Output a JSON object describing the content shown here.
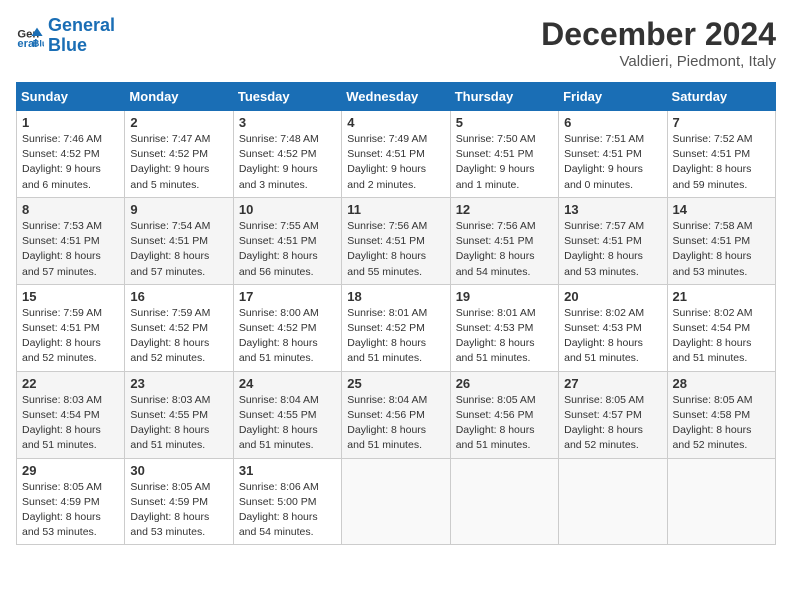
{
  "header": {
    "logo_line1": "General",
    "logo_line2": "Blue",
    "month": "December 2024",
    "location": "Valdieri, Piedmont, Italy"
  },
  "weekdays": [
    "Sunday",
    "Monday",
    "Tuesday",
    "Wednesday",
    "Thursday",
    "Friday",
    "Saturday"
  ],
  "weeks": [
    [
      {
        "day": "1",
        "info": "Sunrise: 7:46 AM\nSunset: 4:52 PM\nDaylight: 9 hours\nand 6 minutes."
      },
      {
        "day": "2",
        "info": "Sunrise: 7:47 AM\nSunset: 4:52 PM\nDaylight: 9 hours\nand 5 minutes."
      },
      {
        "day": "3",
        "info": "Sunrise: 7:48 AM\nSunset: 4:52 PM\nDaylight: 9 hours\nand 3 minutes."
      },
      {
        "day": "4",
        "info": "Sunrise: 7:49 AM\nSunset: 4:51 PM\nDaylight: 9 hours\nand 2 minutes."
      },
      {
        "day": "5",
        "info": "Sunrise: 7:50 AM\nSunset: 4:51 PM\nDaylight: 9 hours\nand 1 minute."
      },
      {
        "day": "6",
        "info": "Sunrise: 7:51 AM\nSunset: 4:51 PM\nDaylight: 9 hours\nand 0 minutes."
      },
      {
        "day": "7",
        "info": "Sunrise: 7:52 AM\nSunset: 4:51 PM\nDaylight: 8 hours\nand 59 minutes."
      }
    ],
    [
      {
        "day": "8",
        "info": "Sunrise: 7:53 AM\nSunset: 4:51 PM\nDaylight: 8 hours\nand 57 minutes."
      },
      {
        "day": "9",
        "info": "Sunrise: 7:54 AM\nSunset: 4:51 PM\nDaylight: 8 hours\nand 57 minutes."
      },
      {
        "day": "10",
        "info": "Sunrise: 7:55 AM\nSunset: 4:51 PM\nDaylight: 8 hours\nand 56 minutes."
      },
      {
        "day": "11",
        "info": "Sunrise: 7:56 AM\nSunset: 4:51 PM\nDaylight: 8 hours\nand 55 minutes."
      },
      {
        "day": "12",
        "info": "Sunrise: 7:56 AM\nSunset: 4:51 PM\nDaylight: 8 hours\nand 54 minutes."
      },
      {
        "day": "13",
        "info": "Sunrise: 7:57 AM\nSunset: 4:51 PM\nDaylight: 8 hours\nand 53 minutes."
      },
      {
        "day": "14",
        "info": "Sunrise: 7:58 AM\nSunset: 4:51 PM\nDaylight: 8 hours\nand 53 minutes."
      }
    ],
    [
      {
        "day": "15",
        "info": "Sunrise: 7:59 AM\nSunset: 4:51 PM\nDaylight: 8 hours\nand 52 minutes."
      },
      {
        "day": "16",
        "info": "Sunrise: 7:59 AM\nSunset: 4:52 PM\nDaylight: 8 hours\nand 52 minutes."
      },
      {
        "day": "17",
        "info": "Sunrise: 8:00 AM\nSunset: 4:52 PM\nDaylight: 8 hours\nand 51 minutes."
      },
      {
        "day": "18",
        "info": "Sunrise: 8:01 AM\nSunset: 4:52 PM\nDaylight: 8 hours\nand 51 minutes."
      },
      {
        "day": "19",
        "info": "Sunrise: 8:01 AM\nSunset: 4:53 PM\nDaylight: 8 hours\nand 51 minutes."
      },
      {
        "day": "20",
        "info": "Sunrise: 8:02 AM\nSunset: 4:53 PM\nDaylight: 8 hours\nand 51 minutes."
      },
      {
        "day": "21",
        "info": "Sunrise: 8:02 AM\nSunset: 4:54 PM\nDaylight: 8 hours\nand 51 minutes."
      }
    ],
    [
      {
        "day": "22",
        "info": "Sunrise: 8:03 AM\nSunset: 4:54 PM\nDaylight: 8 hours\nand 51 minutes."
      },
      {
        "day": "23",
        "info": "Sunrise: 8:03 AM\nSunset: 4:55 PM\nDaylight: 8 hours\nand 51 minutes."
      },
      {
        "day": "24",
        "info": "Sunrise: 8:04 AM\nSunset: 4:55 PM\nDaylight: 8 hours\nand 51 minutes."
      },
      {
        "day": "25",
        "info": "Sunrise: 8:04 AM\nSunset: 4:56 PM\nDaylight: 8 hours\nand 51 minutes."
      },
      {
        "day": "26",
        "info": "Sunrise: 8:05 AM\nSunset: 4:56 PM\nDaylight: 8 hours\nand 51 minutes."
      },
      {
        "day": "27",
        "info": "Sunrise: 8:05 AM\nSunset: 4:57 PM\nDaylight: 8 hours\nand 52 minutes."
      },
      {
        "day": "28",
        "info": "Sunrise: 8:05 AM\nSunset: 4:58 PM\nDaylight: 8 hours\nand 52 minutes."
      }
    ],
    [
      {
        "day": "29",
        "info": "Sunrise: 8:05 AM\nSunset: 4:59 PM\nDaylight: 8 hours\nand 53 minutes."
      },
      {
        "day": "30",
        "info": "Sunrise: 8:05 AM\nSunset: 4:59 PM\nDaylight: 8 hours\nand 53 minutes."
      },
      {
        "day": "31",
        "info": "Sunrise: 8:06 AM\nSunset: 5:00 PM\nDaylight: 8 hours\nand 54 minutes."
      },
      null,
      null,
      null,
      null
    ]
  ]
}
